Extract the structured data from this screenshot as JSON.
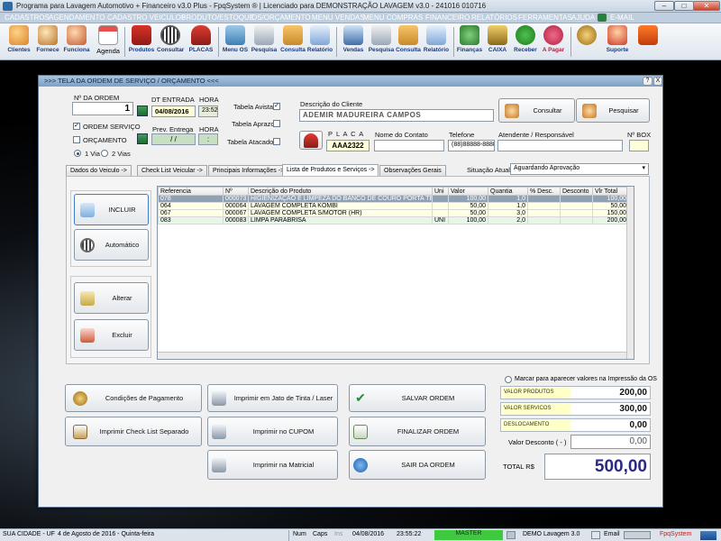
{
  "window": {
    "title": "Programa para Lavagem Automotivo + Financeiro v3.0 Plus - FpqSystem ® | Licenciado para  DEMONSTRAÇÃO LAVAGEM v3.0 - 241016 010716",
    "min": "–",
    "max": "□",
    "close": "✕"
  },
  "menu": [
    "CADASTROS",
    "AGENDAMENTO",
    "CADASTRO VEICULOS",
    "PRODUTO/ESTOQUE",
    "OS/ORÇAMENTO",
    "MENU VENDAS",
    "MENU COMPRAS",
    "FINANCEIRO",
    "RELATÓRIOS",
    "FERRAMENTAS",
    "AJUDA",
    "E-MAIL"
  ],
  "toolbar": [
    "Clientes",
    "Fornece",
    "Funciona",
    "Agenda",
    "Produtos",
    "Consultar",
    "PLACAS",
    "Menu OS",
    "Pesquisa",
    "Consulta",
    "Relatório",
    "Vendas",
    "Pesquisa",
    "Consulta",
    "Relatório",
    "Finanças",
    "CAIXA",
    "Receber",
    "A Pagar",
    "",
    "Suporte",
    ""
  ],
  "dialog": {
    "title": ">>>   TELA DA ORDEM DE SERVIÇO / ORÇAMENTO   <<<",
    "help_btn": "?",
    "close_btn": "X",
    "ordem_label": "Nº DA ORDEM",
    "ordem_value": "1",
    "dt_label": "DT ENTRADA",
    "dt_value": "04/08/2016",
    "hora_label": "HORA",
    "hora_value": "23:52",
    "prev_label": "Prev. Entrega",
    "prev_value": "/    /",
    "prev_hora_label": "HORA",
    "prev_hora_value": ":",
    "tabela_avista": "Tabela Avista",
    "tabela_aprazo": "Tabela Aprazo",
    "tabela_atacado": "Tabela Atacado",
    "ordem_servico": "ORDEM SERVIÇO",
    "orcamento": "ORÇAMENTO",
    "via1": "1 Via",
    "via2": "2 Vias",
    "cliente_label": "Descrição do Cliente",
    "cliente_value": "ADEMIR MADUREIRA CAMPOS",
    "consultar": "Consultar",
    "pesquisar": "Pesquisar",
    "placa_label": "P L A C A",
    "placa_value": "AAA2322",
    "contato_label": "Nome do Contato",
    "contato_value": "",
    "telefone_label": "Telefone",
    "telefone_value": "(88)88888-8888",
    "atendente_label": "Atendente / Responsável",
    "atendente_value": "",
    "nbox_label": "Nº BOX",
    "nbox_value": "",
    "situacao_label": "Situação Atual:",
    "situacao_value": "Aguardando Aprovação"
  },
  "tabs": [
    "Dados do Veiculo ->",
    "Check List Veicular ->",
    "Principais Informações ->",
    "Lista de Produtos e Serviços ->",
    "Observações Gerais"
  ],
  "side_buttons": {
    "incluir": "INCLUIR",
    "automatico": "Automático",
    "alterar": "Alterar",
    "excluir": "Excluir"
  },
  "grid": {
    "columns": [
      "Referencia",
      "Nº",
      "Descrição do Produto",
      "Uni",
      "Valor",
      "Quantia",
      "% Desc.",
      "Desconto",
      "Vlr Total"
    ],
    "rows": [
      [
        "078",
        "000073",
        "HIGIENIZAÇÃO E LIMPEZA DO BANCO DE COURO PORTA TET",
        "",
        "100,00",
        "1,0",
        "",
        "",
        "100,00"
      ],
      [
        "064",
        "000064",
        "LAVAGEM COMPLETA  KOMBI",
        "",
        "50,00",
        "1,0",
        "",
        "",
        "50,00"
      ],
      [
        "067",
        "000067",
        "LAVAGEM COMPLETA S/MOTOR  (HR)",
        "",
        "50,00",
        "3,0",
        "",
        "",
        "150,00"
      ],
      [
        "083",
        "000083",
        "LIMPA PARABRISA",
        "UNI",
        "100,00",
        "2,0",
        "",
        "",
        "200,00"
      ]
    ]
  },
  "bottom_buttons": {
    "condicoes": "Condições de Pagamento",
    "checklist": "Imprimir Check List Separado",
    "jato": "Imprimir em Jato de Tinta / Laser",
    "cupom": "Imprimir no CUPOM",
    "matricial": "Imprimir na Matricial",
    "salvar": "SALVAR ORDEM",
    "finalizar": "FINALIZAR ORDEM",
    "sair": "SAIR DA ORDEM"
  },
  "totals": {
    "marcar": "Marcar para aparecer valores na Impressão da OS",
    "produtos_label": "VALOR PRODUTOS",
    "produtos_value": "200,00",
    "servicos_label": "VALOR SERVICOS",
    "servicos_value": "300,00",
    "deslocamento_label": "DESLOCAMENTO",
    "deslocamento_value": "0,00",
    "desconto_label": "Valor Desconto ( - )",
    "desconto_value": "0,00",
    "total_label": "TOTAL R$",
    "total_value": "500,00"
  },
  "status": {
    "cidade": "SUA CIDADE - UF",
    "data": "4 de Agosto de 2016 - Quinta-feira",
    "num": "Num",
    "caps": "Caps",
    "ins": "Ins",
    "date": "04/08/2016",
    "time": "23:55:22",
    "master": "MASTER",
    "demo": "DEMO Lavagem 3.0",
    "email": "Email",
    "fpq": "FpqSystem"
  }
}
